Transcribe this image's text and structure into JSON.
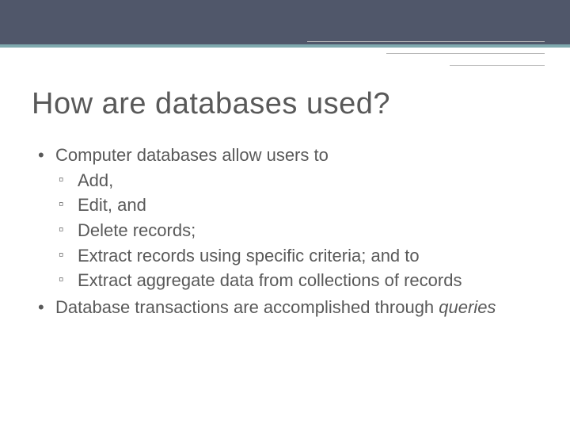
{
  "title": "How are databases used?",
  "bullets": {
    "a": "Computer databases allow users to",
    "a_subs": {
      "s1": "Add,",
      "s2": "Edit, and",
      "s3": "Delete records;",
      "s4": "Extract records using specific criteria; and to",
      "s5": "Extract aggregate data from collections of records"
    },
    "b_pre": "Database transactions are accomplished through ",
    "b_em": "queries"
  }
}
